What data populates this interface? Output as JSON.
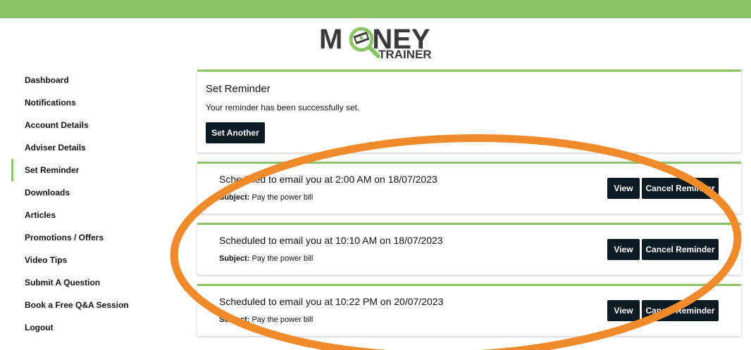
{
  "brand": {
    "logo_main": "M  NEY",
    "logo_sub": "TRAINER",
    "accent": "#8cc565",
    "button_bg": "#0d1b24",
    "annotation_color": "#f08a2a"
  },
  "sidebar": {
    "items": [
      {
        "label": "Dashboard",
        "active": false
      },
      {
        "label": "Notifications",
        "active": false
      },
      {
        "label": "Account Details",
        "active": false
      },
      {
        "label": "Adviser Details",
        "active": false
      },
      {
        "label": "Set Reminder",
        "active": true
      },
      {
        "label": "Downloads",
        "active": false
      },
      {
        "label": "Articles",
        "active": false
      },
      {
        "label": "Promotions / Offers",
        "active": false
      },
      {
        "label": "Video Tips",
        "active": false
      },
      {
        "label": "Submit A Question",
        "active": false
      },
      {
        "label": "Book a Free Q&A Session",
        "active": false
      },
      {
        "label": "Logout",
        "active": false
      }
    ]
  },
  "set_reminder": {
    "title": "Set Reminder",
    "message": "Your reminder has been successfully set.",
    "button_label": "Set Another"
  },
  "reminders": [
    {
      "schedule": "Scheduled to email you at 2:00 AM on 18/07/2023",
      "subject_label": "Subject:",
      "subject": "Pay the power bill",
      "view_label": "View",
      "cancel_label": "Cancel Reminder"
    },
    {
      "schedule": "Scheduled to email you at 10:10 AM on 18/07/2023",
      "subject_label": "Subject:",
      "subject": "Pay the power bill",
      "view_label": "View",
      "cancel_label": "Cancel Reminder"
    },
    {
      "schedule": "Scheduled to email you at 10:22 PM on 20/07/2023",
      "subject_label": "Subject:",
      "subject": "Pay the power bill",
      "view_label": "View",
      "cancel_label": "Cancel Reminder"
    }
  ]
}
